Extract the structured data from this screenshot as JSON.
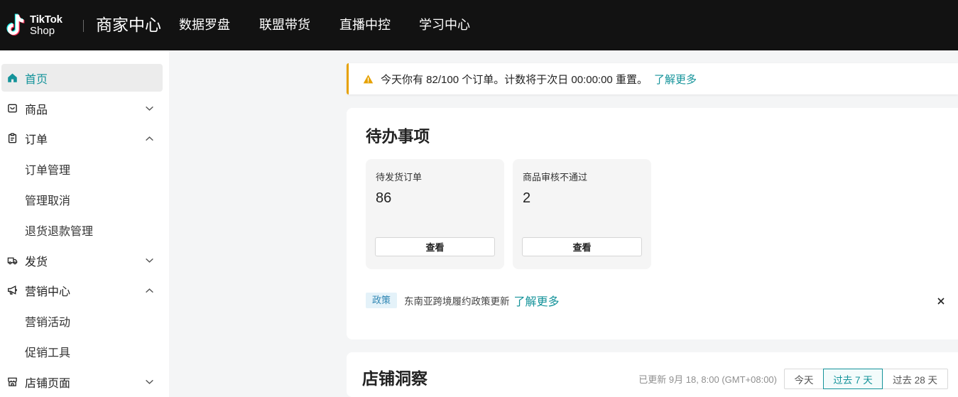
{
  "colors": {
    "accent": "#14939a",
    "warning": "#e6a100",
    "header_bg": "#121212",
    "page_bg": "#f4f5f6"
  },
  "header": {
    "logo": {
      "line1": "TikTok",
      "line2": "Shop",
      "icon": "tiktok-logo-icon"
    },
    "title": "商家中心",
    "nav": [
      {
        "label": "数据罗盘"
      },
      {
        "label": "联盟带货"
      },
      {
        "label": "直播中控"
      },
      {
        "label": "学习中心"
      }
    ]
  },
  "sidebar": {
    "home": {
      "label": "首页",
      "icon": "home-icon",
      "active": true
    },
    "products": {
      "label": "商品",
      "icon": "shopping-bag-icon",
      "chevron": "chevron-down-icon"
    },
    "orders": {
      "label": "订单",
      "icon": "clipboard-icon",
      "chevron": "chevron-up-icon",
      "children": [
        {
          "label": "订单管理"
        },
        {
          "label": "管理取消"
        },
        {
          "label": "退货退款管理"
        }
      ]
    },
    "shipping": {
      "label": "发货",
      "icon": "truck-icon",
      "chevron": "chevron-down-icon"
    },
    "marketing": {
      "label": "营销中心",
      "icon": "megaphone-icon",
      "chevron": "chevron-up-icon",
      "children": [
        {
          "label": "营销活动"
        },
        {
          "label": "促销工具"
        }
      ]
    },
    "store": {
      "label": "店铺页面",
      "icon": "store-icon",
      "chevron": "chevron-down-icon"
    }
  },
  "alert": {
    "icon": "warning-icon",
    "text": "今天你有 82/100 个订单。计数将于次日 00:00:00 重置。",
    "link": "了解更多"
  },
  "todo": {
    "title": "待办事项",
    "tasks": [
      {
        "label": "待发货订单",
        "count": 86,
        "button": "查看"
      },
      {
        "label": "商品审核不通过",
        "count": 2,
        "button": "查看"
      }
    ],
    "policy": {
      "tag": "政策",
      "text": "东南亚跨境履约政策更新",
      "link": "了解更多",
      "close_icon": "close-icon"
    }
  },
  "insights": {
    "title": "店铺洞察",
    "updated": "已更新 9月 18, 8:00 (GMT+08:00)",
    "ranges": [
      {
        "label": "今天"
      },
      {
        "label": "过去 7 天",
        "active": true
      },
      {
        "label": "过去 28 天"
      }
    ]
  }
}
